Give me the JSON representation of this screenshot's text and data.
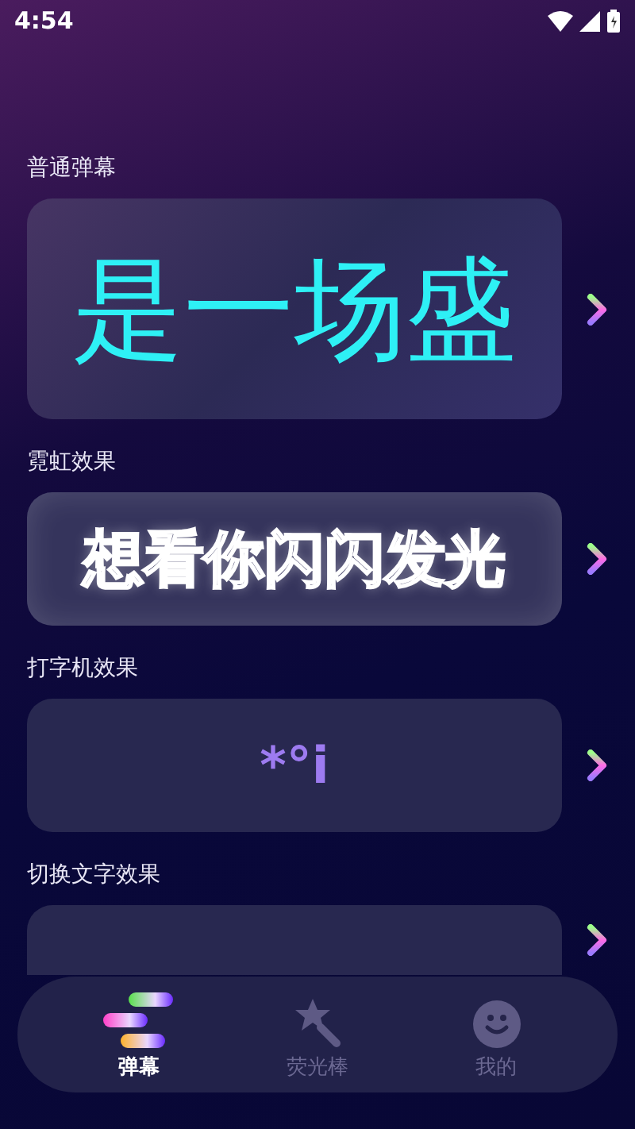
{
  "status_bar": {
    "time": "4:54"
  },
  "sections": [
    {
      "title": "普通弹幕",
      "kind": "plain",
      "sample": "是一场盛"
    },
    {
      "title": "霓虹效果",
      "kind": "neon",
      "sample": "想看你闪闪发光"
    },
    {
      "title": "打字机效果",
      "kind": "typewriter",
      "sample": "*°i"
    },
    {
      "title": "切换文字效果",
      "kind": "switch"
    }
  ],
  "nav": [
    {
      "label": "弹幕",
      "kind": "bars",
      "selected": true
    },
    {
      "label": "荧光棒",
      "kind": "wand",
      "selected": false
    },
    {
      "label": "我的",
      "kind": "smile",
      "selected": false
    }
  ]
}
